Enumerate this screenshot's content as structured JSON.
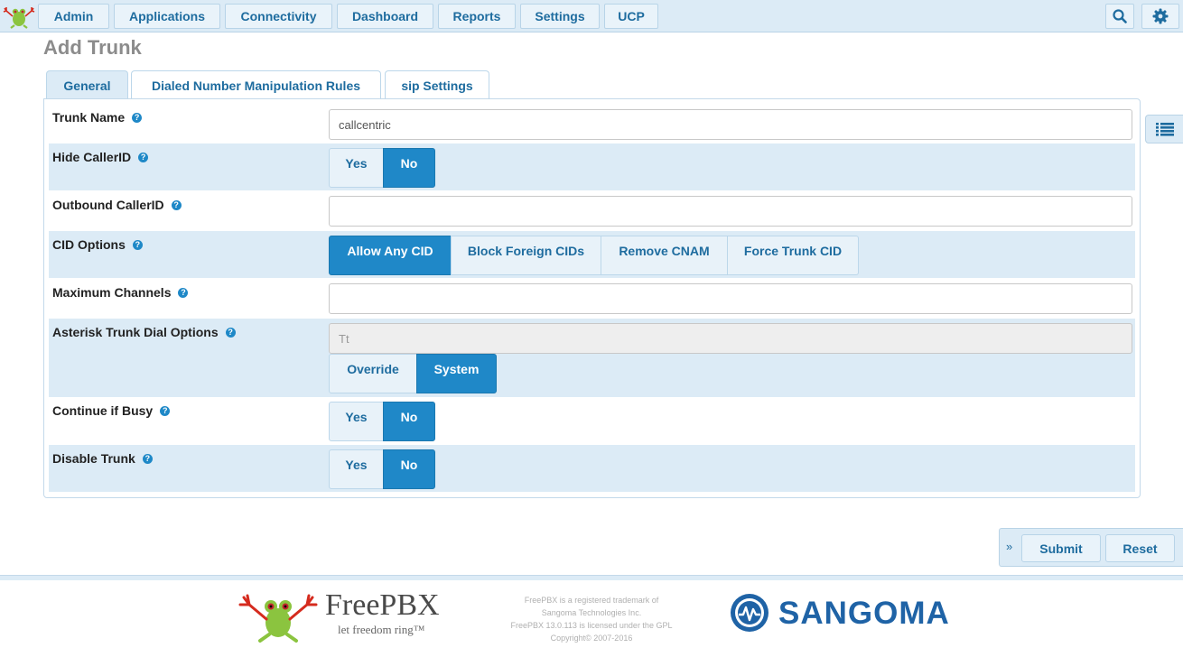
{
  "nav": {
    "items": [
      "Admin",
      "Applications",
      "Connectivity",
      "Dashboard",
      "Reports",
      "Settings",
      "UCP"
    ],
    "search_icon": "search-icon",
    "settings_icon": "gear-icon"
  },
  "page": {
    "title": "Add Trunk"
  },
  "tabs": [
    "General",
    "Dialed Number Manipulation Rules",
    "sip Settings"
  ],
  "form": {
    "trunk_name": {
      "label": "Trunk Name",
      "value": "callcentric"
    },
    "hide_callerid": {
      "label": "Hide CallerID",
      "options": [
        "Yes",
        "No"
      ],
      "selected": "No"
    },
    "outbound_callerid": {
      "label": "Outbound CallerID",
      "value": ""
    },
    "cid_options": {
      "label": "CID Options",
      "options": [
        "Allow Any CID",
        "Block Foreign CIDs",
        "Remove CNAM",
        "Force Trunk CID"
      ],
      "selected": "Allow Any CID"
    },
    "max_channels": {
      "label": "Maximum Channels",
      "value": ""
    },
    "dial_options": {
      "label": "Asterisk Trunk Dial Options",
      "value": "Tt",
      "options": [
        "Override",
        "System"
      ],
      "selected": "System"
    },
    "continue_if_busy": {
      "label": "Continue if Busy",
      "options": [
        "Yes",
        "No"
      ],
      "selected": "No"
    },
    "disable_trunk": {
      "label": "Disable Trunk",
      "options": [
        "Yes",
        "No"
      ],
      "selected": "No"
    }
  },
  "actions": {
    "submit": "Submit",
    "reset": "Reset"
  },
  "footer": {
    "freepbx_name": "FreePBX",
    "freepbx_tagline": "let freedom ring™",
    "legal": [
      "FreePBX is a registered trademark of",
      "Sangoma Technologies Inc.",
      "FreePBX 13.0.113 is licensed under the GPL",
      "Copyright© 2007-2016"
    ],
    "sangoma_name": "SANGOMA"
  },
  "colors": {
    "accent": "#1f88c8",
    "link": "#1e6c9f",
    "shade": "#dcebf6",
    "brand": "#1f63a6"
  }
}
